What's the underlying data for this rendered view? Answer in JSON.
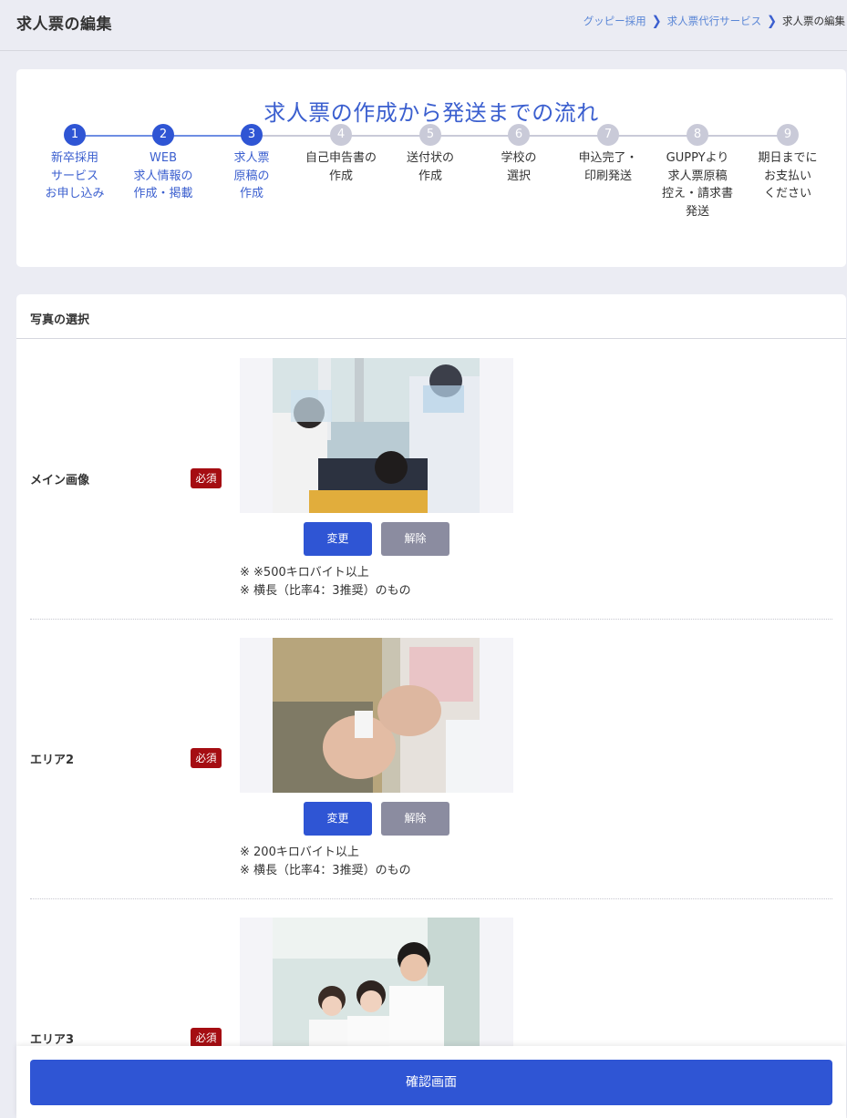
{
  "header": {
    "title": "求人票の編集",
    "breadcrumb": [
      "グッピー採用",
      "求人票代行サービス",
      "求人票の編集"
    ]
  },
  "flow": {
    "title": "求人票の作成から発送までの流れ",
    "steps": [
      {
        "num": "1",
        "label": "新卒採用\nサービス\nお申し込み",
        "status": "done"
      },
      {
        "num": "2",
        "label": "WEB\n求人情報の\n作成・掲載",
        "status": "done"
      },
      {
        "num": "3",
        "label": "求人票\n原稿の\n作成",
        "status": "done"
      },
      {
        "num": "4",
        "label": "自己申告書の\n作成",
        "status": "todo"
      },
      {
        "num": "5",
        "label": "送付状の\n作成",
        "status": "todo"
      },
      {
        "num": "6",
        "label": "学校の\n選択",
        "status": "todo"
      },
      {
        "num": "7",
        "label": "申込完了・\n印刷発送",
        "status": "todo"
      },
      {
        "num": "8",
        "label": "GUPPYより\n求人票原稿\n控え・請求書\n発送",
        "status": "todo"
      },
      {
        "num": "9",
        "label": "期日までに\nお支払い\nください",
        "status": "todo"
      }
    ]
  },
  "photos": {
    "section_title": "写真の選択",
    "required_label": "必須",
    "change_label": "変更",
    "clear_label": "解除",
    "rows": [
      {
        "label": "メイン画像",
        "image": "dental-treatment-photo",
        "notes": [
          "※ ※500キロバイト以上",
          "※ 横長（比率4：3推奨）のもの"
        ]
      },
      {
        "label": "エリア2",
        "image": "dental-instrument-photo",
        "notes": [
          "※ 200キロバイト以上",
          "※ 横長（比率4：3推奨）のもの"
        ]
      },
      {
        "label": "エリア3",
        "image": "staff-group-photo",
        "notes": []
      }
    ]
  },
  "footer": {
    "confirm_label": "確認画面"
  },
  "colors": {
    "primary": "#2f55d4",
    "accent_text": "#3b5fcf",
    "required": "#a50d12",
    "inactive": "#c9cad8",
    "background": "#ebecf3"
  }
}
